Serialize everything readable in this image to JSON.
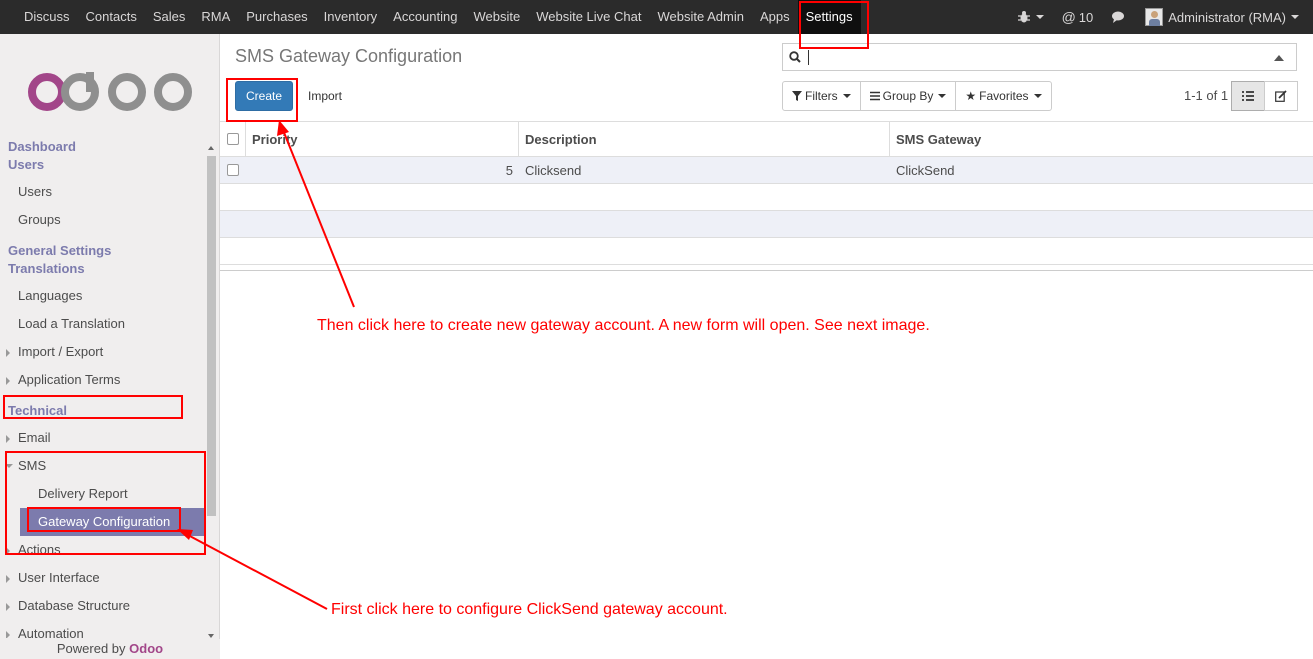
{
  "topnav": {
    "menu": [
      "Discuss",
      "Contacts",
      "Sales",
      "RMA",
      "Purchases",
      "Inventory",
      "Accounting",
      "Website",
      "Website Live Chat",
      "Website Admin",
      "Apps",
      "Settings"
    ],
    "active": "Settings",
    "notifications": "10",
    "user": "Administrator (RMA)"
  },
  "sidebar": {
    "logo_text": "odoo",
    "dashboard": "Dashboard",
    "users_header": "Users",
    "users": "Users",
    "groups": "Groups",
    "general_settings": "General Settings",
    "translations_header": "Translations",
    "languages": "Languages",
    "load_translation": "Load a Translation",
    "import_export": "Import / Export",
    "application_terms": "Application Terms",
    "technical": "Technical",
    "email": "Email",
    "sms": "SMS",
    "delivery_report": "Delivery Report",
    "gateway_configuration": "Gateway Configuration",
    "actions": "Actions",
    "user_interface": "User Interface",
    "database_structure": "Database Structure",
    "automation": "Automation",
    "powered_by": "Powered by",
    "powered_brand": "Odoo"
  },
  "control": {
    "title": "SMS Gateway Configuration",
    "create": "Create",
    "import": "Import",
    "filters": "Filters",
    "group_by": "Group By",
    "favorites": "Favorites",
    "pager": "1-1 of 1"
  },
  "list": {
    "columns": [
      "Priority",
      "Description",
      "SMS Gateway"
    ],
    "rows": [
      {
        "priority": "5",
        "description": "Clicksend",
        "gateway": "ClickSend"
      }
    ]
  },
  "annotations": {
    "note_create": "Then click here to create new gateway account. A new form will open. See next image.",
    "note_config": "First click here to configure ClickSend gateway account."
  },
  "colors": {
    "annotation": "#ff0000",
    "brand": "#7c7bad",
    "primary": "#337ab7"
  }
}
